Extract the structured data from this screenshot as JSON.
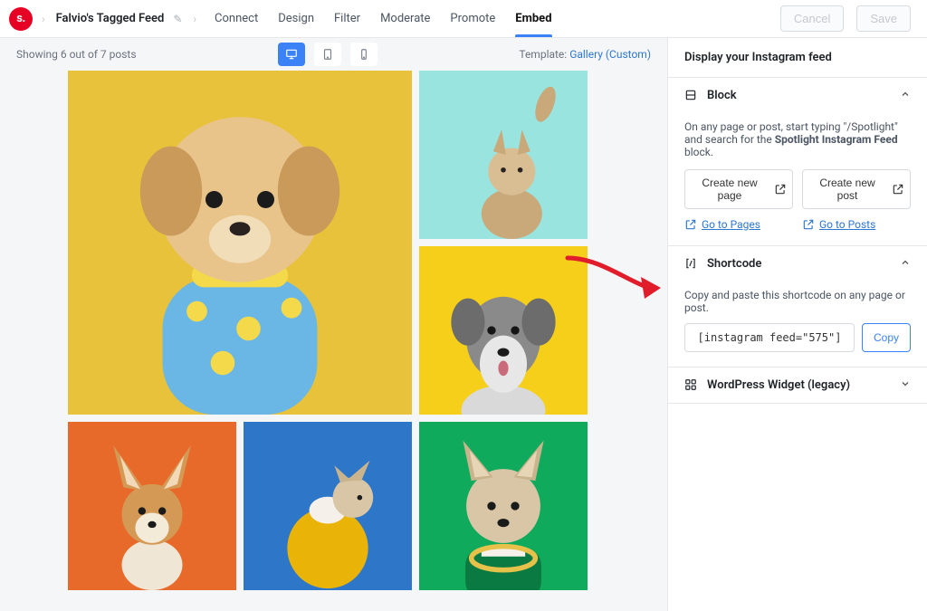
{
  "header": {
    "feed_name": "Falvio's Tagged Feed",
    "tabs": [
      "Connect",
      "Design",
      "Filter",
      "Moderate",
      "Promote",
      "Embed"
    ],
    "active_tab": 5,
    "cancel": "Cancel",
    "save": "Save"
  },
  "canvas": {
    "count_text": "Showing 6 out of 7 posts",
    "template_prefix": "Template: ",
    "template_name": "Gallery (Custom)"
  },
  "sidebar": {
    "title": "Display your Instagram feed",
    "block": {
      "title": "Block",
      "body_before": "On any page or post, start typing \"/Spotlight\" and search for the ",
      "body_bold": "Spotlight Instagram Feed",
      "body_after": " block.",
      "btn_page": "Create new page",
      "btn_post": "Create new post",
      "link_pages": "Go to Pages",
      "link_posts": "Go to Posts"
    },
    "shortcode": {
      "title": "Shortcode",
      "body": "Copy and paste this shortcode on any page or post.",
      "code": "[instagram feed=\"575\"]",
      "copy": "Copy"
    },
    "widget": {
      "title": "WordPress Widget (legacy)"
    }
  }
}
